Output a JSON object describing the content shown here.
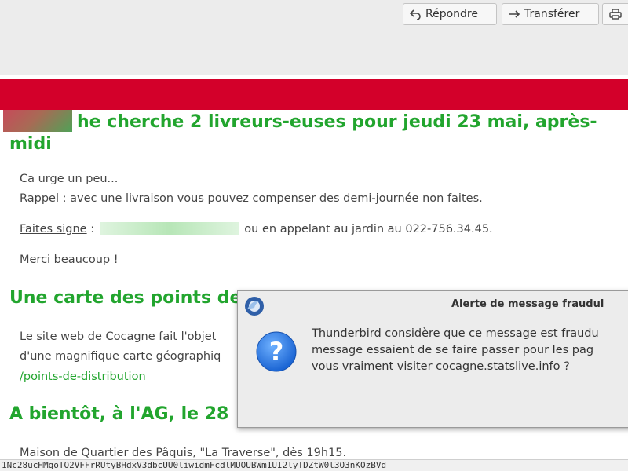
{
  "toolbar": {
    "reply_label": "Répondre",
    "forward_label": "Transférer"
  },
  "email": {
    "heading1": "he cherche 2 livreurs-euses pour jeudi 23 mai, après-midi",
    "line1": "Ca urge un peu...",
    "rappel_label": "Rappel",
    "rappel_text": " : avec une livraison vous pouvez compenser des demi-journée non faites.",
    "faites_label": "Faites signe",
    "faites_prefix": " : ",
    "faites_suffix": " ou en appelant au jardin au 022-756.34.45.",
    "thanks": "Merci beaucoup !",
    "heading2": "Une carte des points de",
    "para2_line1": "Le site web de Cocagne fait l'objet",
    "para2_line2": "d'une magnifique carte géographiq",
    "para2_link": "/points-de-distribution",
    "heading3": "A bientôt, à l'AG, le 28",
    "para3": "Maison de Quartier des Pâquis, \"La Traverse\", dès 19h15."
  },
  "dialog": {
    "title": "Alerte de message fraudul",
    "message_line1": "Thunderbird considère que ce message est fraudu",
    "message_line2": "message essaient de se faire passer pour les pag",
    "message_line3": "vous vraiment visiter cocagne.statslive.info ?"
  },
  "statusbar": {
    "url": "1Nc28ucHMgoTO2VFFrRUtyBHdxV3dbcUU0liwidmFcdlMUOUBWm1UI2lyTDZtW0l3O3nKOzBVd"
  },
  "colors": {
    "banner": "#d3002a",
    "heading": "#22a52e"
  }
}
